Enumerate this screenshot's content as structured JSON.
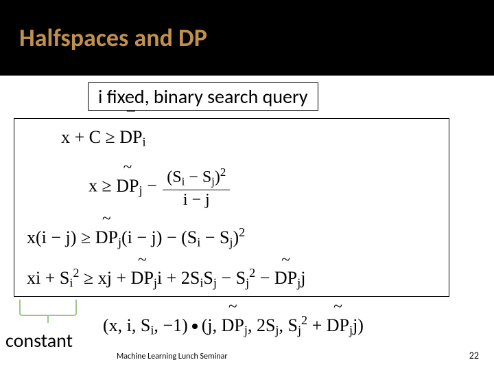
{
  "title": "Halfspaces and DP",
  "query_label": "i fixed, binary search query",
  "eq": {
    "line1": {
      "lhs_pre": "x + C ≥ ",
      "dp_accent": "¯",
      "dp_text": "DP",
      "sub": "i"
    },
    "line2": {
      "lhs_pre": "x ≥ ",
      "dp_accent": "~",
      "dp_text": "DP",
      "sub": "j",
      "minus": " − ",
      "num_open": "(S",
      "num_sub1": "i",
      "num_mid": " − S",
      "num_sub2": "j",
      "num_close": ")",
      "num_sup": "2",
      "den_pre": "i − j"
    },
    "line3": {
      "lhs": "x(i − j) ≥ ",
      "dp_accent": "~",
      "dp_text": "DP",
      "sub": "j",
      "tail": "(i − j) − (S",
      "tail_sub1": "i",
      "tail_mid": " − S",
      "tail_sub2": "j",
      "tail_close": ")",
      "tail_sup": "2"
    },
    "line4": {
      "p1": "xi + S",
      "p1_sub": "i",
      "p1_sup": "2",
      "p2": " ≥ xj + ",
      "dp1_accent": "~",
      "dp1_text": "DP",
      "dp1_sub": "j",
      "p3": "i + 2S",
      "p3_sub1": "i",
      "p3_mid": "S",
      "p3_sub2": "j",
      "p4": " − S",
      "p4_sub": "j",
      "p4_sup": "2",
      "p5": " − ",
      "dp2_accent": "~",
      "dp2_text": "DP",
      "dp2_sub": "j",
      "p6": "j"
    }
  },
  "constant_label": "constant",
  "dotline": {
    "left_open": "(x, i, S",
    "left_sub": "i",
    "left_close": ", −1)",
    "rj": "(j, ",
    "dp1_accent": "~",
    "dp1_text": "DP",
    "dp1_sub": "j",
    "r2": ", 2S",
    "r2_sub": "j",
    "r3": ", S",
    "r3_sub": "j",
    "r3_sup": "2",
    "r4": " + ",
    "dp2_accent": "~",
    "dp2_text": "DP",
    "dp2_sub": "j",
    "r5": "j)"
  },
  "footer": "Machine Learning Lunch Seminar",
  "page": "22"
}
